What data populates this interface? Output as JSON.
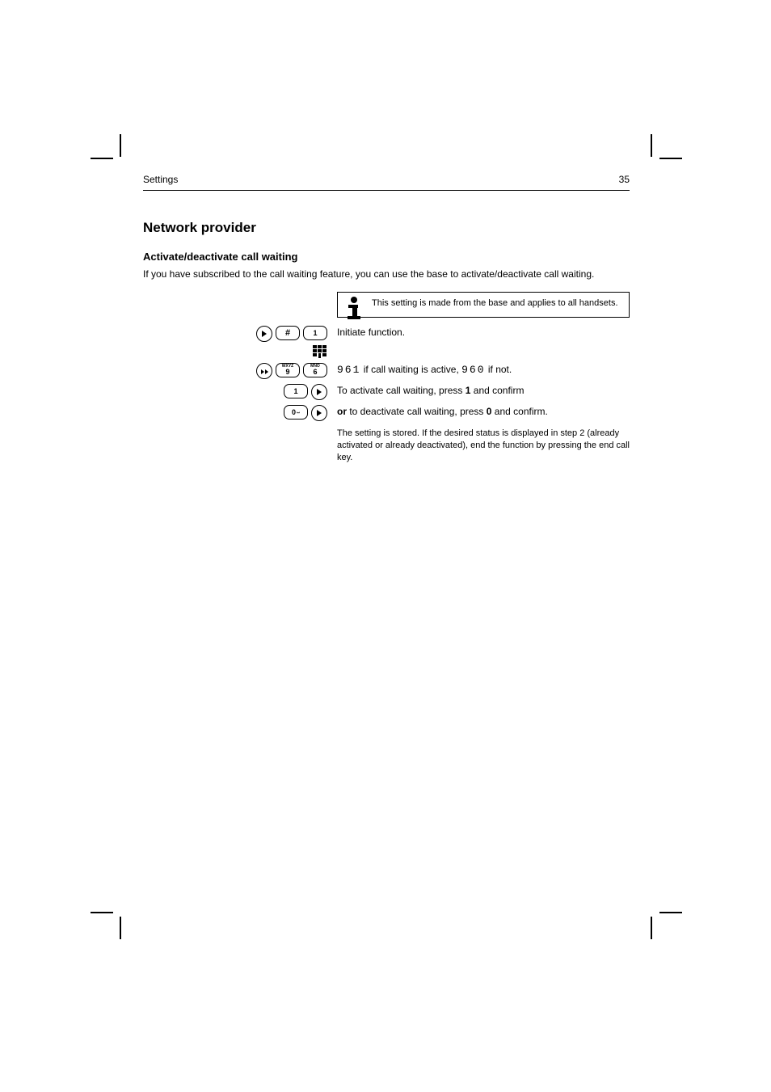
{
  "header": {
    "left": "Settings",
    "right": "35"
  },
  "section_title": "Network provider",
  "subsection_title": "Activate/deactivate call waiting",
  "intro": "If you have subscribed to the call waiting feature, you can use the base to activate/deactivate call waiting.",
  "info_note": "This setting is made from the base and applies to all handsets.",
  "steps": [
    {
      "keys": "menu-hash-1",
      "text": "Initiate function.",
      "icon": "menu"
    },
    {
      "keys": "scroll-9-6",
      "seg_on": "961",
      "seg_off": "960",
      "text_mid": " if call waiting is active, ",
      "text_end": " if not."
    },
    {
      "keys": "1-enter",
      "text_html": "To activate call waiting, press <b>1</b> and confirm "
    },
    {
      "keys": "0-enter",
      "bold_or": "or",
      "text_html": " to deactivate call waiting, press <b>0</b> and confirm."
    }
  ],
  "outro": "The setting is stored. If the desired status is displayed in step 2 (already activated or already deactivated), end the function by pressing the end call key.",
  "icons": {
    "enter": "enter-icon",
    "scroll": "scroll-icon",
    "hash": "#",
    "key1": "1",
    "key0_main": "0",
    "key9_sup": "WXYZ",
    "key9_main": "9",
    "key6_sup": "MNO",
    "key6_main": "6",
    "menu": "menu-icon",
    "info": "info-icon"
  }
}
